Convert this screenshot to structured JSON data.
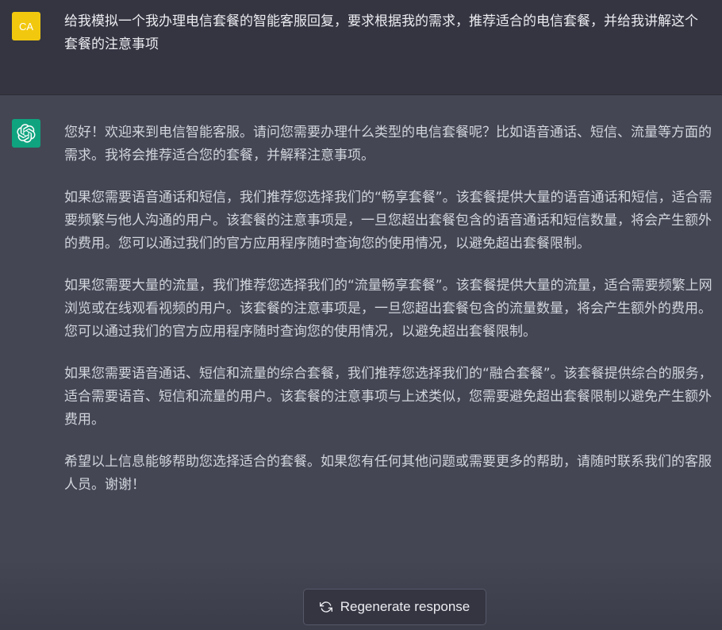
{
  "colors": {
    "user_bg": "#343541",
    "assistant_bg": "#444654",
    "user_avatar": "#f2c80f",
    "bot_avatar": "#10a37f",
    "text": "#d1d5db"
  },
  "user_message": {
    "avatar_initials": "CA",
    "text": "给我模拟一个我办理电信套餐的智能客服回复，要求根据我的需求，推荐适合的电信套餐，并给我讲解这个套餐的注意事项"
  },
  "assistant_message": {
    "avatar_icon": "openai-logo-icon",
    "paragraphs": [
      "您好！欢迎来到电信智能客服。请问您需要办理什么类型的电信套餐呢？比如语音通话、短信、流量等方面的需求。我将会推荐适合您的套餐，并解释注意事项。",
      "如果您需要语音通话和短信，我们推荐您选择我们的“畅享套餐”。该套餐提供大量的语音通话和短信，适合需要频繁与他人沟通的用户。该套餐的注意事项是，一旦您超出套餐包含的语音通话和短信数量，将会产生额外的费用。您可以通过我们的官方应用程序随时查询您的使用情况，以避免超出套餐限制。",
      "如果您需要大量的流量，我们推荐您选择我们的“流量畅享套餐”。该套餐提供大量的流量，适合需要频繁上网浏览或在线观看视频的用户。该套餐的注意事项是，一旦您超出套餐包含的流量数量，将会产生额外的费用。您可以通过我们的官方应用程序随时查询您的使用情况，以避免超出套餐限制。",
      "如果您需要语音通话、短信和流量的综合套餐，我们推荐您选择我们的“融合套餐”。该套餐提供综合的服务，适合需要语音、短信和流量的用户。该套餐的注意事项与上述类似，您需要避免超出套餐限制以避免产生额外费用。",
      "希望以上信息能够帮助您选择适合的套餐。如果您有任何其他问题或需要更多的帮助，请随时联系我们的客服人员。谢谢！"
    ]
  },
  "regenerate_button": {
    "icon": "refresh-icon",
    "label": "Regenerate response"
  }
}
